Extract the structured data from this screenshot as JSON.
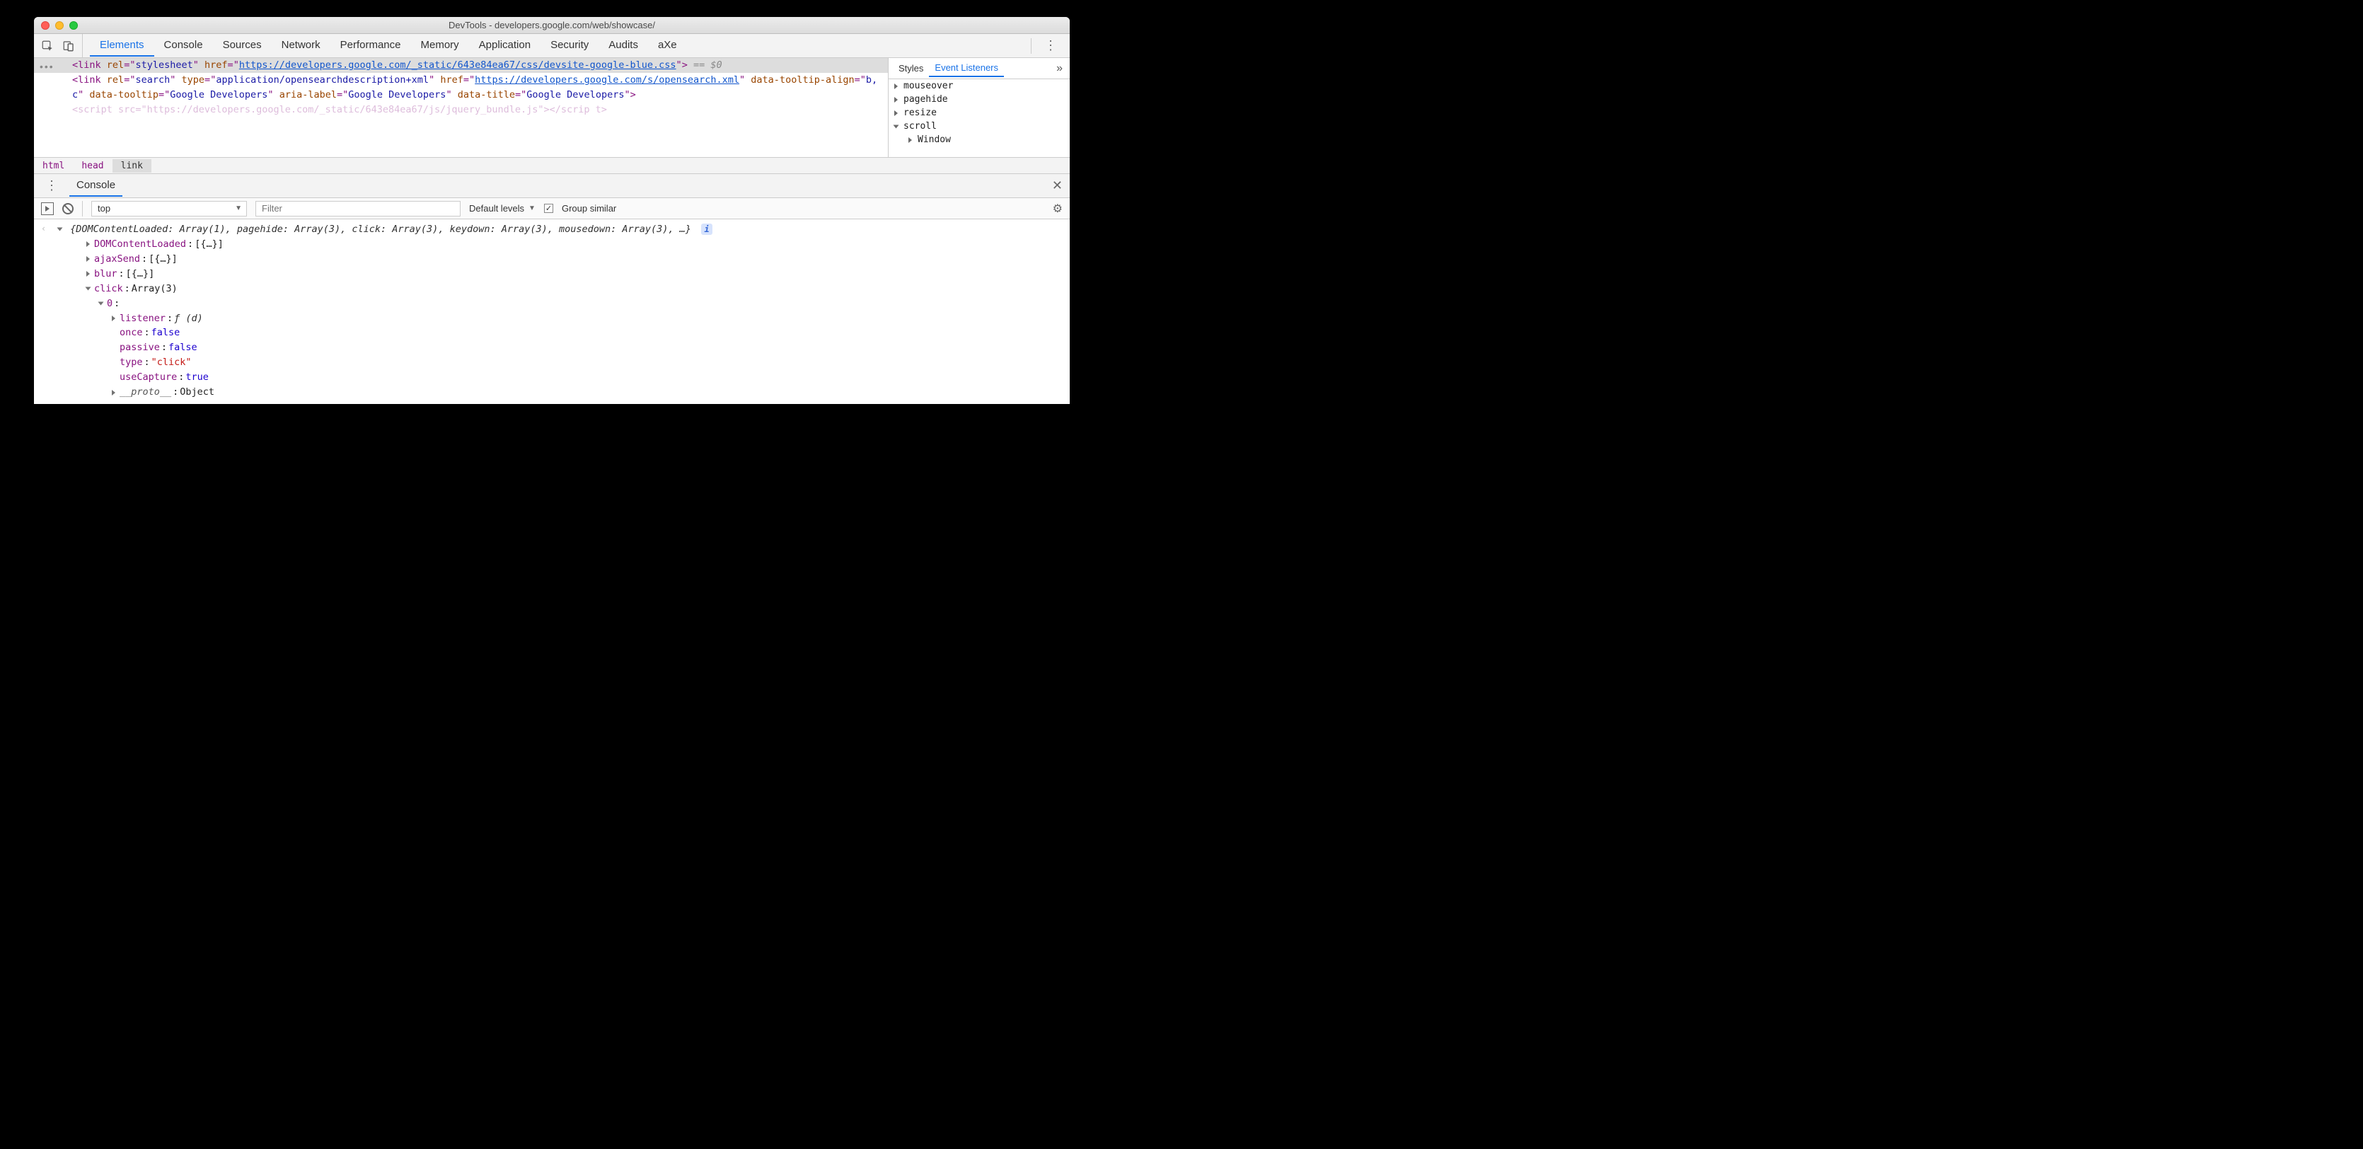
{
  "window_title": "DevTools - developers.google.com/web/showcase/",
  "tabs": [
    "Elements",
    "Console",
    "Sources",
    "Network",
    "Performance",
    "Memory",
    "Application",
    "Security",
    "Audits",
    "aXe"
  ],
  "active_tab": "Elements",
  "dom": {
    "line1": {
      "tag": "link",
      "attrs": [
        {
          "name": "rel",
          "val": "stylesheet"
        },
        {
          "name": "href",
          "val": "https://developers.google.com/_static/643e84ea67/css/devsite-google-blue.css",
          "link": true
        }
      ],
      "suffix": " == $0"
    },
    "line2": {
      "tag": "link",
      "attrs": [
        {
          "name": "rel",
          "val": "search"
        },
        {
          "name": "type",
          "val": "application/opensearchdescription+xml"
        },
        {
          "name": "href",
          "val": "https://developers.google.com/s/opensearch.xml",
          "link": true
        },
        {
          "name": "data-tooltip-align",
          "val": "b,c"
        },
        {
          "name": "data-tooltip",
          "val": "Google Developers"
        },
        {
          "name": "aria-label",
          "val": "Google Developers"
        },
        {
          "name": "data-title",
          "val": "Google Developers"
        }
      ]
    },
    "line3_truncated": "<script src=\"https://developers.google.com/_static/643e84ea67/js/jquery_bundle.js\"></scrip t>"
  },
  "sidebar": {
    "tabs": [
      "Styles",
      "Event Listeners"
    ],
    "active": "Event Listeners",
    "more": "»",
    "listeners": [
      {
        "name": "mouseover",
        "expanded": false
      },
      {
        "name": "pagehide",
        "expanded": false
      },
      {
        "name": "resize",
        "expanded": false
      },
      {
        "name": "scroll",
        "expanded": true,
        "children": [
          {
            "name": "Window"
          }
        ]
      }
    ]
  },
  "breadcrumb": [
    "html",
    "head",
    "link"
  ],
  "drawer": {
    "tab": "Console"
  },
  "console_toolbar": {
    "context": "top",
    "filter_placeholder": "Filter",
    "levels_label": "Default levels",
    "group_similar_label": "Group similar",
    "group_similar_checked": true
  },
  "console": {
    "summary": "{DOMContentLoaded: Array(1), pagehide: Array(3), click: Array(3), keydown: Array(3), mousedown: Array(3), …}",
    "rows": [
      {
        "indent": 1,
        "tri": "right",
        "key": "DOMContentLoaded",
        "val": "[{…}]"
      },
      {
        "indent": 1,
        "tri": "right",
        "key": "ajaxSend",
        "val": "[{…}]"
      },
      {
        "indent": 1,
        "tri": "right",
        "key": "blur",
        "val": "[{…}]"
      },
      {
        "indent": 1,
        "tri": "down",
        "key": "click",
        "val": "Array(3)"
      },
      {
        "indent": 2,
        "tri": "down",
        "key": "0",
        "val": ""
      },
      {
        "indent": 3,
        "tri": "right",
        "key": "listener",
        "val": "ƒ (d)",
        "fn": true
      },
      {
        "indent": 3,
        "key": "once",
        "val": "false",
        "num": true
      },
      {
        "indent": 3,
        "key": "passive",
        "val": "false",
        "num": true
      },
      {
        "indent": 3,
        "key": "type",
        "val": "\"click\"",
        "str": true
      },
      {
        "indent": 3,
        "key": "useCapture",
        "val": "true",
        "num": true
      },
      {
        "indent": 3,
        "tri": "right",
        "key": "__proto__",
        "val": "Object",
        "dim": true
      }
    ]
  }
}
